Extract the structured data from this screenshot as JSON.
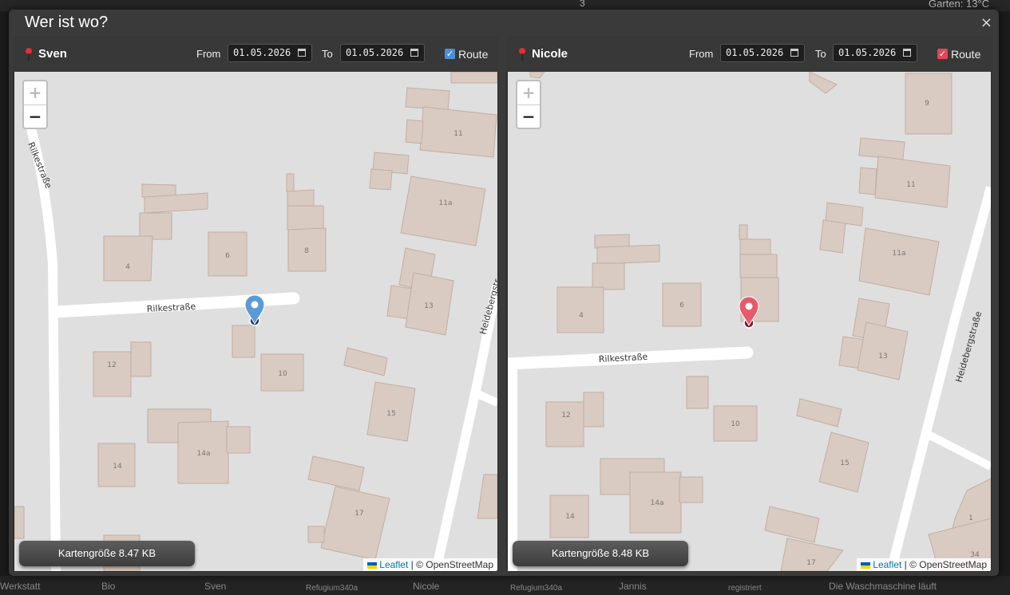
{
  "dialog": {
    "title": "Wer ist wo?",
    "close": "×"
  },
  "labels": {
    "from": "From",
    "to": "To",
    "route": "Route",
    "zoom_in": "+",
    "zoom_out": "−"
  },
  "attribution": {
    "leaflet": "Leaflet",
    "sep": " | © OpenStreetMap"
  },
  "panels": [
    {
      "name": "Sven",
      "from": "01.05.2026",
      "to": "01.05.2026",
      "route_checked": true,
      "route_color": "#4a90d9",
      "marker_color": "#5b9bd5",
      "map_size": "Kartengröße 8.47 KB"
    },
    {
      "name": "Nicole",
      "from": "01.05.2026",
      "to": "01.05.2026",
      "route_checked": true,
      "route_color": "#e0475a",
      "marker_color": "#e55b6a",
      "map_size": "Kartengröße 8.48 KB"
    }
  ],
  "map": {
    "streets": [
      "Rilkestraße",
      "Heidebergstraße"
    ],
    "house_numbers": [
      "11",
      "11a",
      "9",
      "4",
      "6",
      "8",
      "13",
      "12",
      "10",
      "15",
      "14",
      "14a",
      "17",
      "1",
      "34"
    ]
  },
  "background": {
    "top_right": "Garten:  13°C",
    "top_num": "3",
    "bottom": [
      "Werkstatt",
      "Bio",
      "Sven",
      "Refugium340a",
      "Nicole",
      "Refugium340a",
      "Jannis",
      "registriert",
      "Die Waschmaschine läuft"
    ]
  }
}
